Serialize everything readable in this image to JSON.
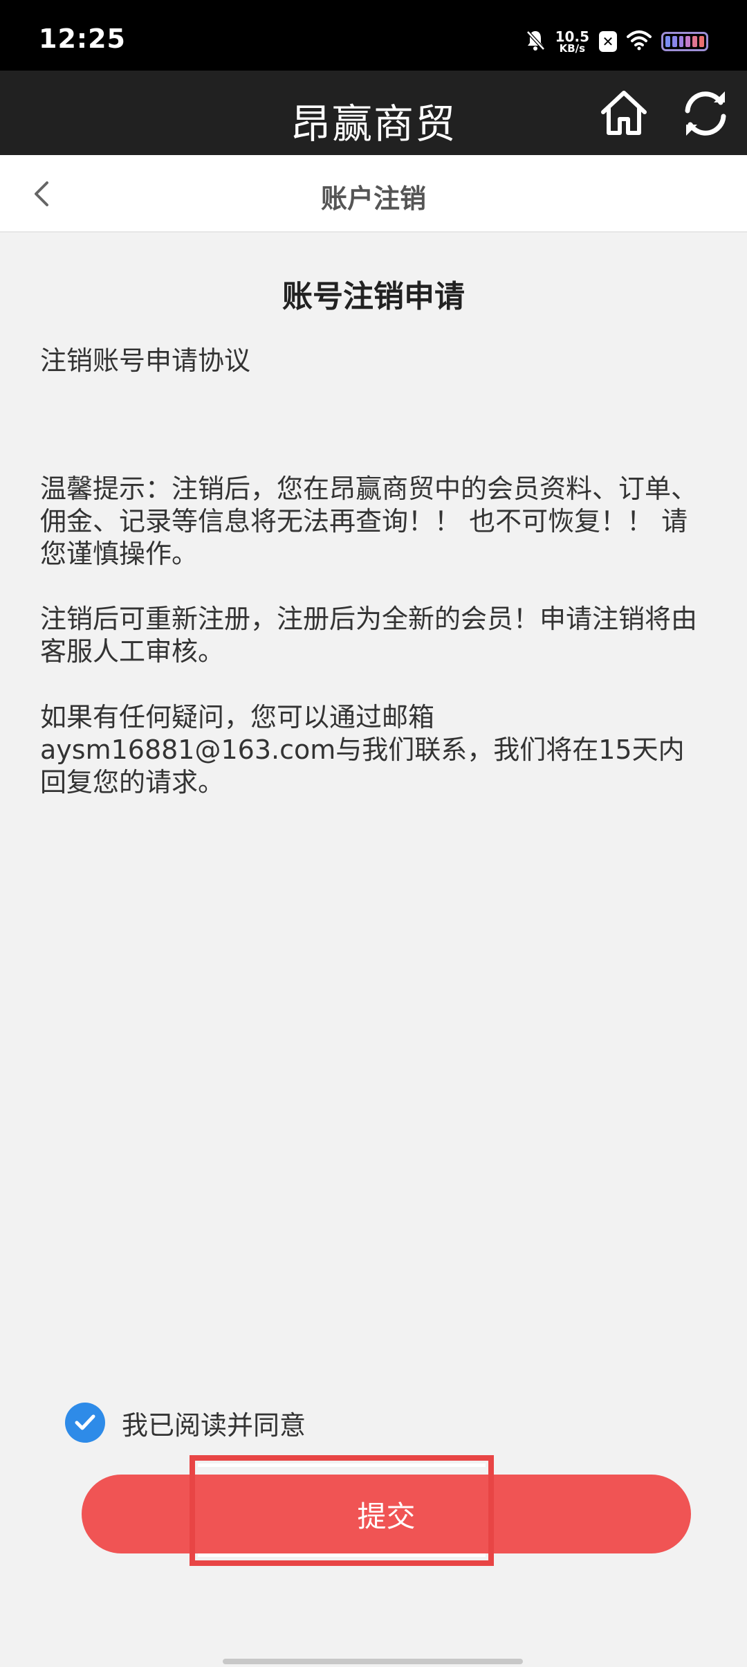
{
  "status_bar": {
    "time": "12:25",
    "net_speed_value": "10.5",
    "net_speed_unit": "KB/s",
    "icons": [
      "mute-bell-icon",
      "sim-x-icon",
      "wifi-icon",
      "battery-icon"
    ],
    "battery_color": "#9e8fd6"
  },
  "header": {
    "app_title": "昂赢商贸",
    "home_icon": "home-icon",
    "refresh_icon": "refresh-icon"
  },
  "sub_nav": {
    "title": "账户注销",
    "back_icon": "chevron-left-icon"
  },
  "content": {
    "title": "账号注销申请",
    "subtitle": "注销账号申请协议",
    "paragraph_1": "温馨提示：注销后，您在昂赢商贸中的会员资料、订单、佣金、记录等信息将无法再查询！！ 也不可恢复！！ 请您谨慎操作。",
    "paragraph_2": "注销后可重新注册，注册后为全新的会员！申请注销将由客服人工审核。",
    "paragraph_3": "如果有任何疑问，您可以通过邮箱aysm16881@163.com与我们联系，我们将在15天内回复您的请求。"
  },
  "agreement": {
    "checked": true,
    "label": "我已阅读并同意"
  },
  "submit": {
    "label": "提交",
    "color": "#f05454"
  },
  "colors": {
    "accent_blue": "#2e8be8",
    "header_bg": "#212121",
    "page_bg": "#f2f2f2"
  }
}
